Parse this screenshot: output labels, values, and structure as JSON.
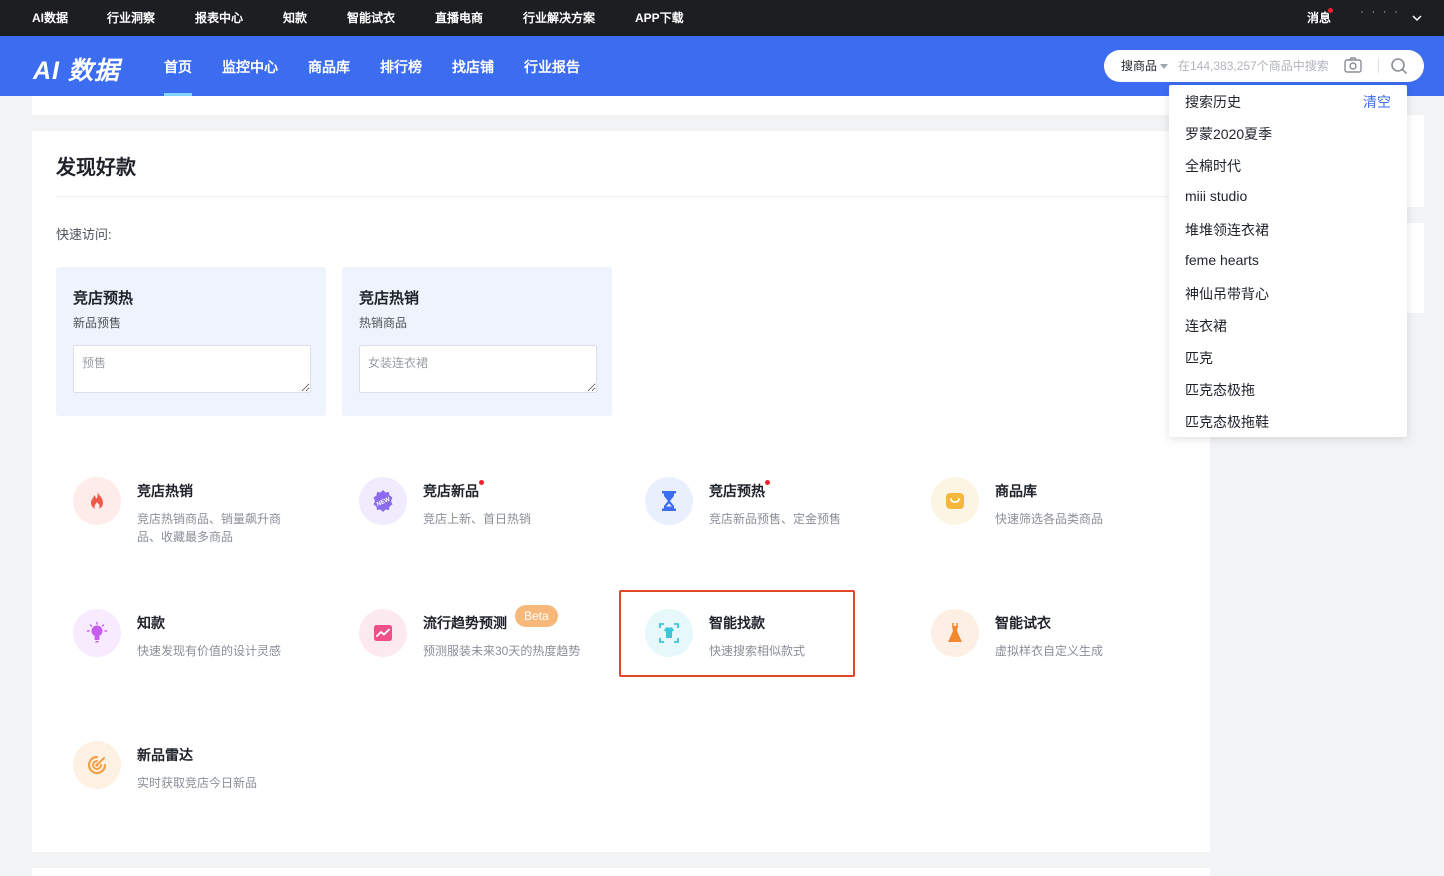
{
  "topbar": {
    "nav": [
      "AI数据",
      "行业洞察",
      "报表中心",
      "知款",
      "智能试衣",
      "直播电商",
      "行业解决方案",
      "APP下载"
    ],
    "message": "消息",
    "user": "· · · ·"
  },
  "header": {
    "logo": "AI 数据",
    "nav": [
      "首页",
      "监控中心",
      "商品库",
      "排行榜",
      "找店铺",
      "行业报告"
    ],
    "active_nav": "首页",
    "search": {
      "type": "搜商品",
      "placeholder": "在144,383,257个商品中搜索"
    }
  },
  "main": {
    "title": "发现好款",
    "quick_label": "快速访问:",
    "quick_cards": [
      {
        "title": "竞店预热",
        "subtitle": "新品预售",
        "placeholder": "预售"
      },
      {
        "title": "竞店热销",
        "subtitle": "热销商品",
        "placeholder": "女装连衣裙"
      }
    ],
    "features": [
      {
        "title": "竞店热销",
        "desc": "竞店热销商品、销量飙升商品、收藏最多商品",
        "icon": "flame-icon",
        "color": "#f05a4a",
        "bg": "#fdecea"
      },
      {
        "title": "竞店新品",
        "desc": "竞店上新、首日热销",
        "icon": "new-badge-icon",
        "color": "#8b6cf0",
        "bg": "#f0ecfd",
        "dot": true
      },
      {
        "title": "竞店预热",
        "desc": "竞店新品预售、定金预售",
        "icon": "hourglass-icon",
        "color": "#3c6cf0",
        "bg": "#e9effd",
        "dot": true
      },
      {
        "title": "商品库",
        "desc": "快速筛选各品类商品",
        "icon": "shopping-bag-icon",
        "color": "#f5b83d",
        "bg": "#fdf5e4"
      },
      {
        "title": "知款",
        "desc": "快速发现有价值的设计灵感",
        "icon": "lightbulb-icon",
        "color": "#c65cf0",
        "bg": "#f7ebfd"
      },
      {
        "title": "流行趋势预测",
        "desc": "预测服装未来30天的热度趋势",
        "icon": "trend-chart-icon",
        "color": "#f0508a",
        "bg": "#fdeaf1",
        "badge": "Beta"
      },
      {
        "title": "智能找款",
        "desc": "快速搜索相似款式",
        "icon": "scan-shirt-icon",
        "color": "#3cc6d8",
        "bg": "#e6f8fa"
      },
      {
        "title": "智能试衣",
        "desc": "虚拟样衣自定义生成",
        "icon": "dress-icon",
        "color": "#f08a30",
        "bg": "#fdefe3"
      },
      {
        "title": "新品雷达",
        "desc": "实时获取竞店今日新品",
        "icon": "radar-icon",
        "color": "#f5a040",
        "bg": "#fdf1e4"
      }
    ]
  },
  "search_history": {
    "title": "搜索历史",
    "clear": "清空",
    "items": [
      "罗蒙2020夏季",
      "全棉时代",
      "miii studio",
      "堆堆领连衣裙",
      "feme hearts",
      "神仙吊带背心",
      "连衣裙",
      "匹克",
      "匹克态极拖",
      "匹克态极拖鞋"
    ]
  }
}
